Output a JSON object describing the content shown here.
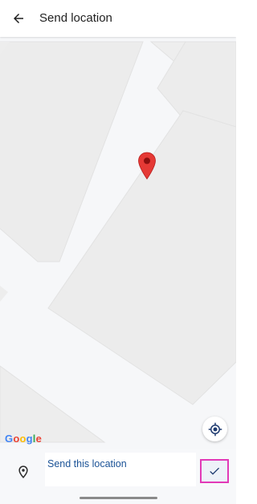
{
  "appbar": {
    "title": "Send location",
    "back_icon": "arrow-left-icon"
  },
  "map": {
    "marker_icon": "map-marker-icon",
    "marker_color": "#e53935",
    "attribution": [
      "G",
      "o",
      "o",
      "g",
      "l",
      "e"
    ],
    "attribution_colors": [
      "#4285f4",
      "#ea4335",
      "#fbbc05",
      "#4285f4",
      "#34a853",
      "#ea4335"
    ],
    "my_location_icon": "my-location-icon"
  },
  "bottom": {
    "pin_icon": "location-pin-icon",
    "send_label": "Send this location",
    "confirm_icon": "check-icon",
    "accent": "#1a5296",
    "highlight": "#e23ab7"
  }
}
